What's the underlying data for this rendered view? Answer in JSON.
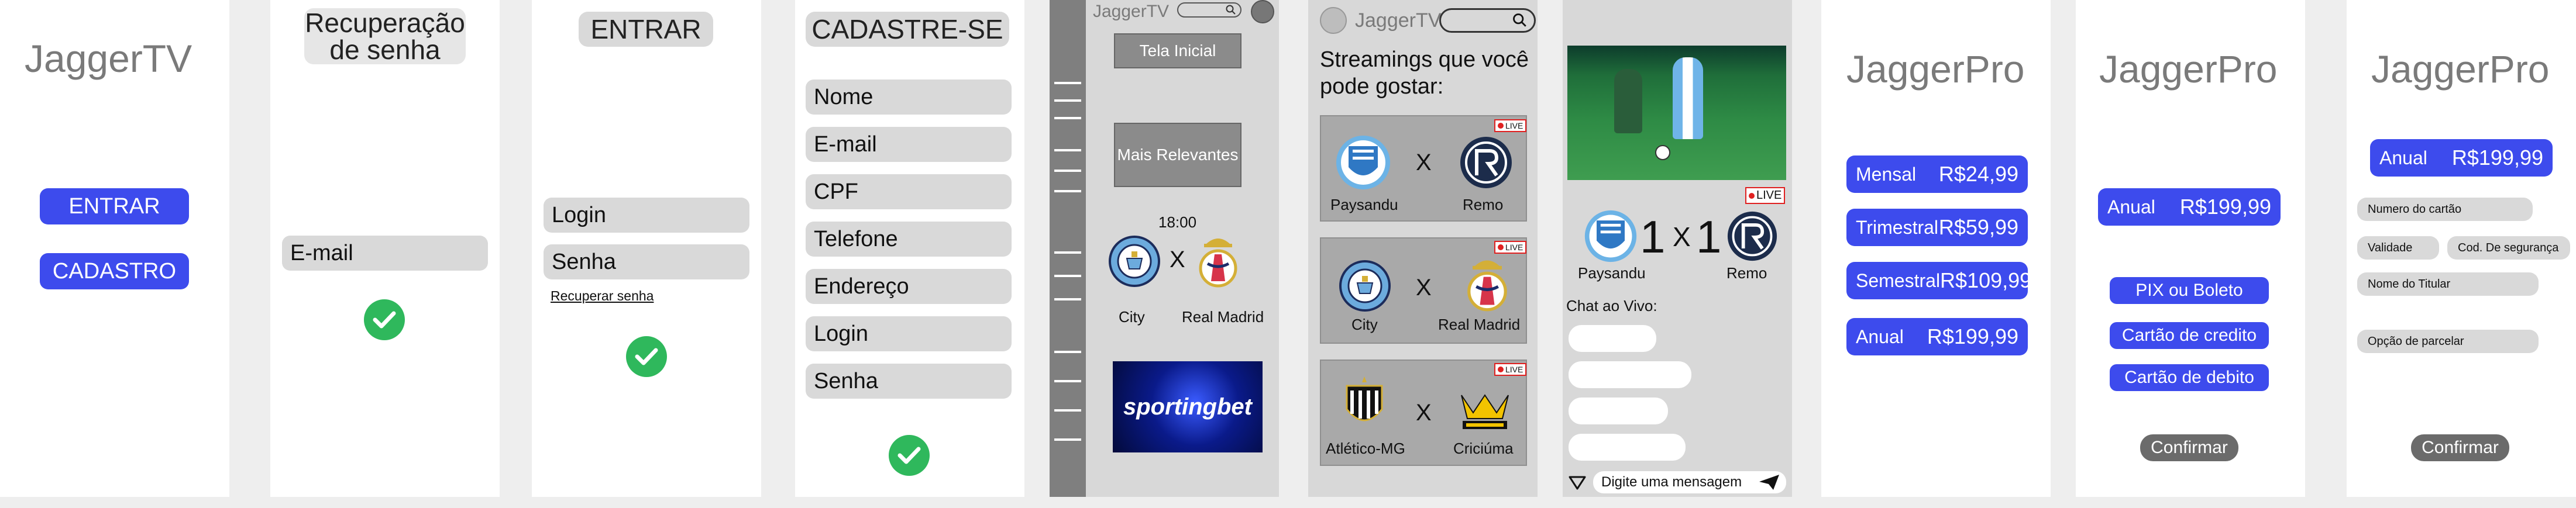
{
  "screen1": {
    "brand": "JaggerTV",
    "enter_label": "ENTRAR",
    "signup_label": "CADASTRO"
  },
  "screen2": {
    "title_line1": "Recuperação",
    "title_line2": "de senha",
    "email_label": "E-mail"
  },
  "screen3": {
    "title": "ENTRAR",
    "login_label": "Login",
    "password_label": "Senha",
    "recover_link": "Recuperar senha"
  },
  "screen4": {
    "title": "CADASTRE-SE",
    "fields": [
      "Nome",
      "E-mail",
      "CPF",
      "Telefone",
      "Endereço",
      "Login",
      "Senha"
    ]
  },
  "screen5": {
    "brand": "JaggerTV",
    "home_button": "Tela Inicial",
    "relevant_button": "Mais Relevantes",
    "time": "18:00",
    "team_home": "City",
    "team_away": "Real Madrid",
    "versus": "X",
    "ad_text": "sportingbet"
  },
  "screen6": {
    "brand": "JaggerTV",
    "heading": "Streamings que você pode gostar:",
    "versus": "X",
    "live": "LIVE",
    "matches": [
      {
        "home": "Paysandu",
        "away": "Remo"
      },
      {
        "home": "City",
        "away": "Real Madrid"
      },
      {
        "home": "Atlético-MG",
        "away": "Criciúma"
      }
    ]
  },
  "screen7": {
    "home": "Paysandu",
    "away": "Remo",
    "score_home": "1",
    "score_sep": "X",
    "score_away": "1",
    "live": "LIVE",
    "chat_label": "Chat ao Vivo:",
    "message_placeholder": "Digite uma mensagem"
  },
  "screen8": {
    "brand": "JaggerPro",
    "plans": [
      {
        "name": "Mensal",
        "price": "R$24,99"
      },
      {
        "name": "Trimestral",
        "price": "R$59,99"
      },
      {
        "name": "Semestral",
        "price": "R$109,99"
      },
      {
        "name": "Anual",
        "price": "R$199,99"
      }
    ]
  },
  "screen9": {
    "brand": "JaggerPro",
    "plan_name": "Anual",
    "plan_price": "R$199,99",
    "options": [
      "PIX ou Boleto",
      "Cartão de credito",
      "Cartão de debito"
    ],
    "confirm": "Confirmar"
  },
  "screen10": {
    "brand": "JaggerPro",
    "plan_name": "Anual",
    "plan_price": "R$199,99",
    "card_number": "Numero do cartão",
    "validity": "Validade",
    "security_code": "Cod. De segurança",
    "holder_name": "Nome do Titular",
    "installments": "Opção de parcelar",
    "confirm": "Confirmar"
  },
  "colors": {
    "accent": "#3d4bed",
    "success": "#2fb85c",
    "live": "#e02020"
  }
}
